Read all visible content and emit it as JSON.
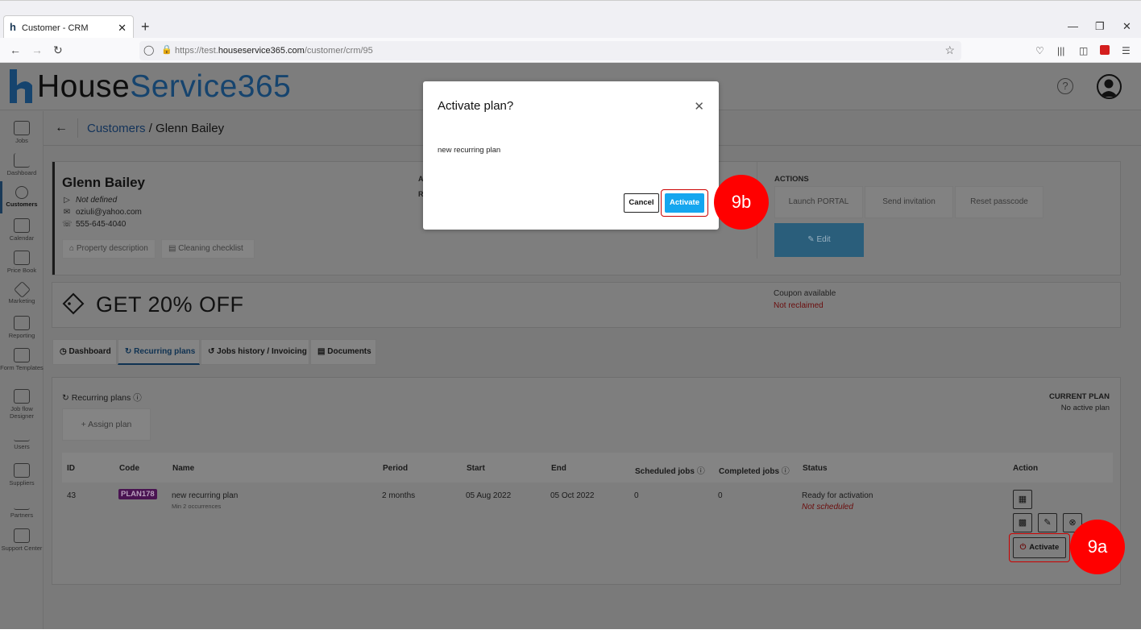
{
  "browser": {
    "tab_title": "Customer - CRM",
    "tab_favicon": "h",
    "tab_close": "✕",
    "new_tab": "+",
    "url_prefix": "https://test.",
    "url_domain": "houseservice365.com",
    "url_path": "/customer/crm/95"
  },
  "app": {
    "logo_house": "House",
    "logo_service": "Service365",
    "help": "?"
  },
  "sidebar": {
    "items": [
      {
        "label": "Jobs"
      },
      {
        "label": "Dashboard"
      },
      {
        "label": "Customers"
      },
      {
        "label": "Calendar"
      },
      {
        "label": "Price Book"
      },
      {
        "label": "Marketing"
      },
      {
        "label": "Reporting"
      },
      {
        "label": "Form Templates"
      },
      {
        "label": "Job flow Designer"
      },
      {
        "label": "Users"
      },
      {
        "label": "Suppliers"
      },
      {
        "label": "Partners"
      },
      {
        "label": "Support Center"
      }
    ]
  },
  "breadcrumb": {
    "link": "Customers",
    "separator": " / ",
    "current": "Glenn Bailey"
  },
  "customer": {
    "name": "Glenn Bailey",
    "type": "Not defined",
    "email": "oziuli@yahoo.com",
    "phone": "555-645-4040",
    "property_btn": "Property description",
    "checklist_btn": "Cleaning checklist",
    "partial_label_1": "A",
    "partial_label_2": "R"
  },
  "actions": {
    "label": "ACTIONS",
    "launch": "Launch PORTAL",
    "invite": "Send invitation",
    "reset": "Reset passcode",
    "edit": "Edit"
  },
  "coupon": {
    "text": "GET 20% OFF",
    "available": "Coupon available",
    "status": "Not reclaimed"
  },
  "tabs": [
    {
      "label": "Dashboard"
    },
    {
      "label": "Recurring plans"
    },
    {
      "label": "Jobs history / Invoicing"
    },
    {
      "label": "Documents"
    }
  ],
  "plans": {
    "title": "Recurring plans",
    "assign": "Assign plan",
    "current_plan_label": "CURRENT PLAN",
    "current_plan_value": "No active plan",
    "columns": [
      "ID",
      "Code",
      "Name",
      "Period",
      "Start",
      "End",
      "Scheduled jobs",
      "Completed jobs",
      "Status",
      "Action"
    ],
    "row": {
      "id": "43",
      "code": "PLAN178",
      "name": "new recurring plan",
      "name_sub": "Min 2 occurrences",
      "period": "2 months",
      "start": "05 Aug 2022",
      "end": "05 Oct 2022",
      "scheduled": "0",
      "completed": "0",
      "status": "Ready for activation",
      "status_sub": "Not scheduled",
      "activate": "Activate"
    }
  },
  "modal": {
    "title": "Activate plan?",
    "close": "✕",
    "body": "new recurring plan",
    "cancel": "Cancel",
    "activate": "Activate"
  },
  "callouts": {
    "a": "9a",
    "b": "9b"
  },
  "colors": {
    "accent": "#15a6ef",
    "callout": "#ff0000",
    "plan_code_bg": "#4a1452",
    "overlay_gray": "#7a7a7a"
  }
}
